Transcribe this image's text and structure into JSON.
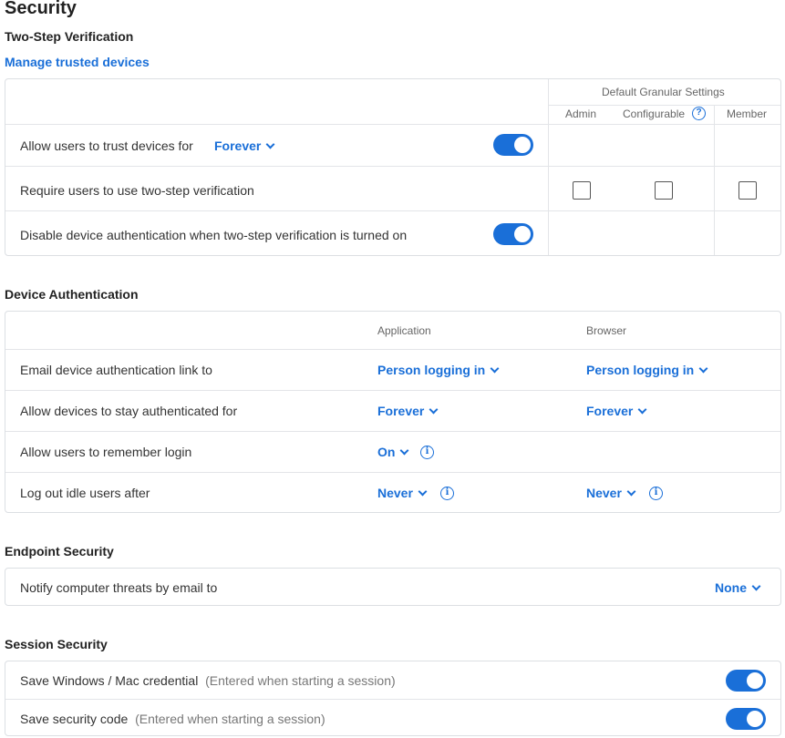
{
  "page": {
    "title": "Security"
  },
  "two_step": {
    "heading": "Two-Step Verification",
    "manage_link": "Manage trusted devices",
    "granular_header": "Default Granular Settings",
    "columns": [
      "Admin",
      "Configurable",
      "Member"
    ],
    "rows": [
      {
        "label": "Allow users to trust devices for",
        "dropdown": "Forever",
        "toggle": "on"
      },
      {
        "label": "Require users to use two-step verification",
        "checkboxes": [
          false,
          false,
          false
        ]
      },
      {
        "label": "Disable device authentication when two-step verification is turned on",
        "toggle": "on"
      }
    ]
  },
  "device_auth": {
    "heading": "Device Authentication",
    "col_application": "Application",
    "col_browser": "Browser",
    "rows": [
      {
        "label": "Email device authentication link to",
        "application": "Person logging in",
        "browser": "Person logging in"
      },
      {
        "label": "Allow devices to stay authenticated for",
        "application": "Forever",
        "browser": "Forever"
      },
      {
        "label": "Allow users to remember login",
        "application": "On"
      },
      {
        "label": "Log out idle users after",
        "application": "Never",
        "browser": "Never"
      }
    ]
  },
  "endpoint": {
    "heading": "Endpoint Security",
    "label": "Notify computer threats by email to",
    "value": "None"
  },
  "session": {
    "heading": "Session Security",
    "rows": [
      {
        "label": "Save Windows / Mac credential",
        "note": "(Entered when starting a session)",
        "toggle": "on"
      },
      {
        "label": "Save security code",
        "note": "(Entered when starting a session)",
        "toggle": "on"
      }
    ]
  },
  "colors": {
    "accent": "#1a6fd8",
    "border": "#dcdfe3"
  },
  "icons": {
    "dropdown": "chevron-down-icon",
    "info": "info-icon",
    "help": "question-circle-icon"
  }
}
